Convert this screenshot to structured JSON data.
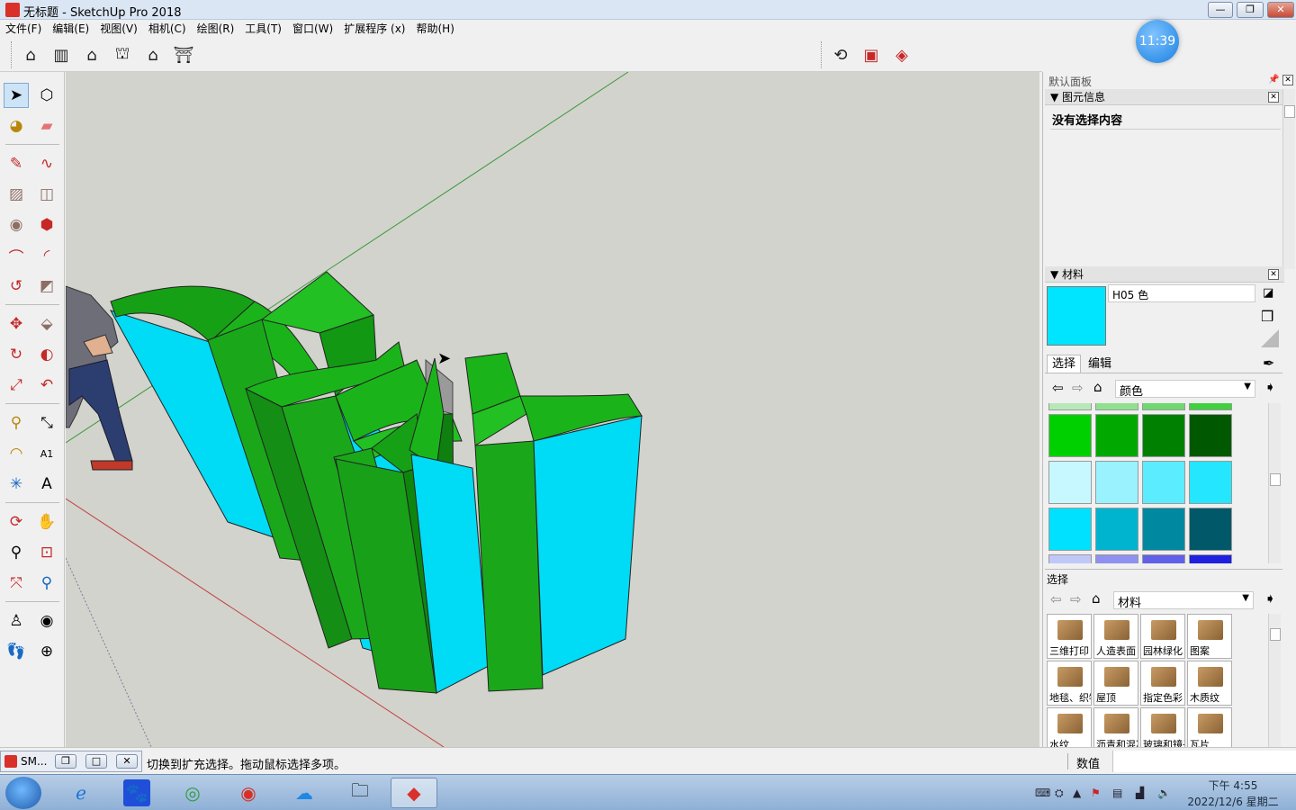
{
  "window": {
    "title": "无标题 - SketchUp Pro 2018",
    "controls": [
      "minimize",
      "restore",
      "close"
    ]
  },
  "menu": [
    "文件(F)",
    "编辑(E)",
    "视图(V)",
    "相机(C)",
    "绘图(R)",
    "工具(T)",
    "窗口(W)",
    "扩展程序 (x)",
    "帮助(H)"
  ],
  "toolbar": {
    "views": [
      "iso-view-icon",
      "front-view-icon",
      "top-view-icon",
      "right-view-icon",
      "back-view-icon",
      "left-view-icon"
    ],
    "right_icons": [
      "warehouse-icon",
      "extension-warehouse-icon",
      "send-to-layout-icon"
    ]
  },
  "clock_badge": "11:39",
  "tools": [
    "select-icon",
    "make-component-icon",
    "paint-bucket-icon",
    "eraser-icon",
    "line-icon",
    "freehand-icon",
    "rectangle-icon",
    "rotated-rectangle-icon",
    "circle-icon",
    "polygon-icon",
    "arc-icon",
    "2pt-arc-icon",
    "3pt-arc-icon",
    "pie-icon",
    "move-icon",
    "push-pull-icon",
    "rotate-icon",
    "follow-me-icon",
    "scale-icon",
    "offset-icon",
    "tape-measure-icon",
    "dimension-icon",
    "protractor-icon",
    "text-icon",
    "axes-icon",
    "3d-text-icon",
    "orbit-icon",
    "pan-icon",
    "zoom-icon",
    "zoom-window-icon",
    "zoom-extents-icon",
    "previous-view-icon",
    "position-camera-icon",
    "look-around-icon",
    "walk-icon",
    "section-plane-icon"
  ],
  "tray": {
    "title": "默认面板",
    "entity_info": {
      "title": "图元信息",
      "message": "没有选择内容"
    },
    "materials": {
      "title": "材料",
      "current_name": "H05 色",
      "current_color": "#00e5ff",
      "tabs": [
        "选择",
        "编辑"
      ],
      "collection": "颜色",
      "swatches": [
        [
          "#00d000",
          "#00a800",
          "#008000",
          "#005800"
        ],
        [
          "#c8f8ff",
          "#9af2ff",
          "#5cecff",
          "#24e6ff"
        ],
        [
          "#00e0ff",
          "#00b4d0",
          "#0088a0",
          "#005868"
        ]
      ],
      "swatch_top_strip": [
        "#b8e8b8",
        "#90e090",
        "#70d870",
        "#40d040"
      ],
      "swatch_bottom_strip": [
        "#c0c8f8",
        "#9090f0",
        "#6060e8",
        "#2020e0"
      ],
      "secondary_label": "选择",
      "library": "材料",
      "folders": [
        "三维打印",
        "人造表面",
        "园林绿化",
        "图案",
        "地毯、织物",
        "屋顶",
        "指定色彩",
        "木质纹",
        "水纹",
        "沥青和混凝土",
        "玻璃和镜子",
        "瓦片"
      ]
    }
  },
  "status": {
    "text": "。切换到扩充选择。拖动鼠标选择多项。",
    "value_label": "数值",
    "mini_window_label": "SM..."
  },
  "taskbar": {
    "apps": [
      "ie-icon",
      "baidu-icon",
      "browser-icon",
      "chrome-icon",
      "cloud-icon",
      "folder-icon",
      "sketchup-icon"
    ],
    "time": "下午 4:55",
    "date": "2022/12/6 星期二"
  }
}
